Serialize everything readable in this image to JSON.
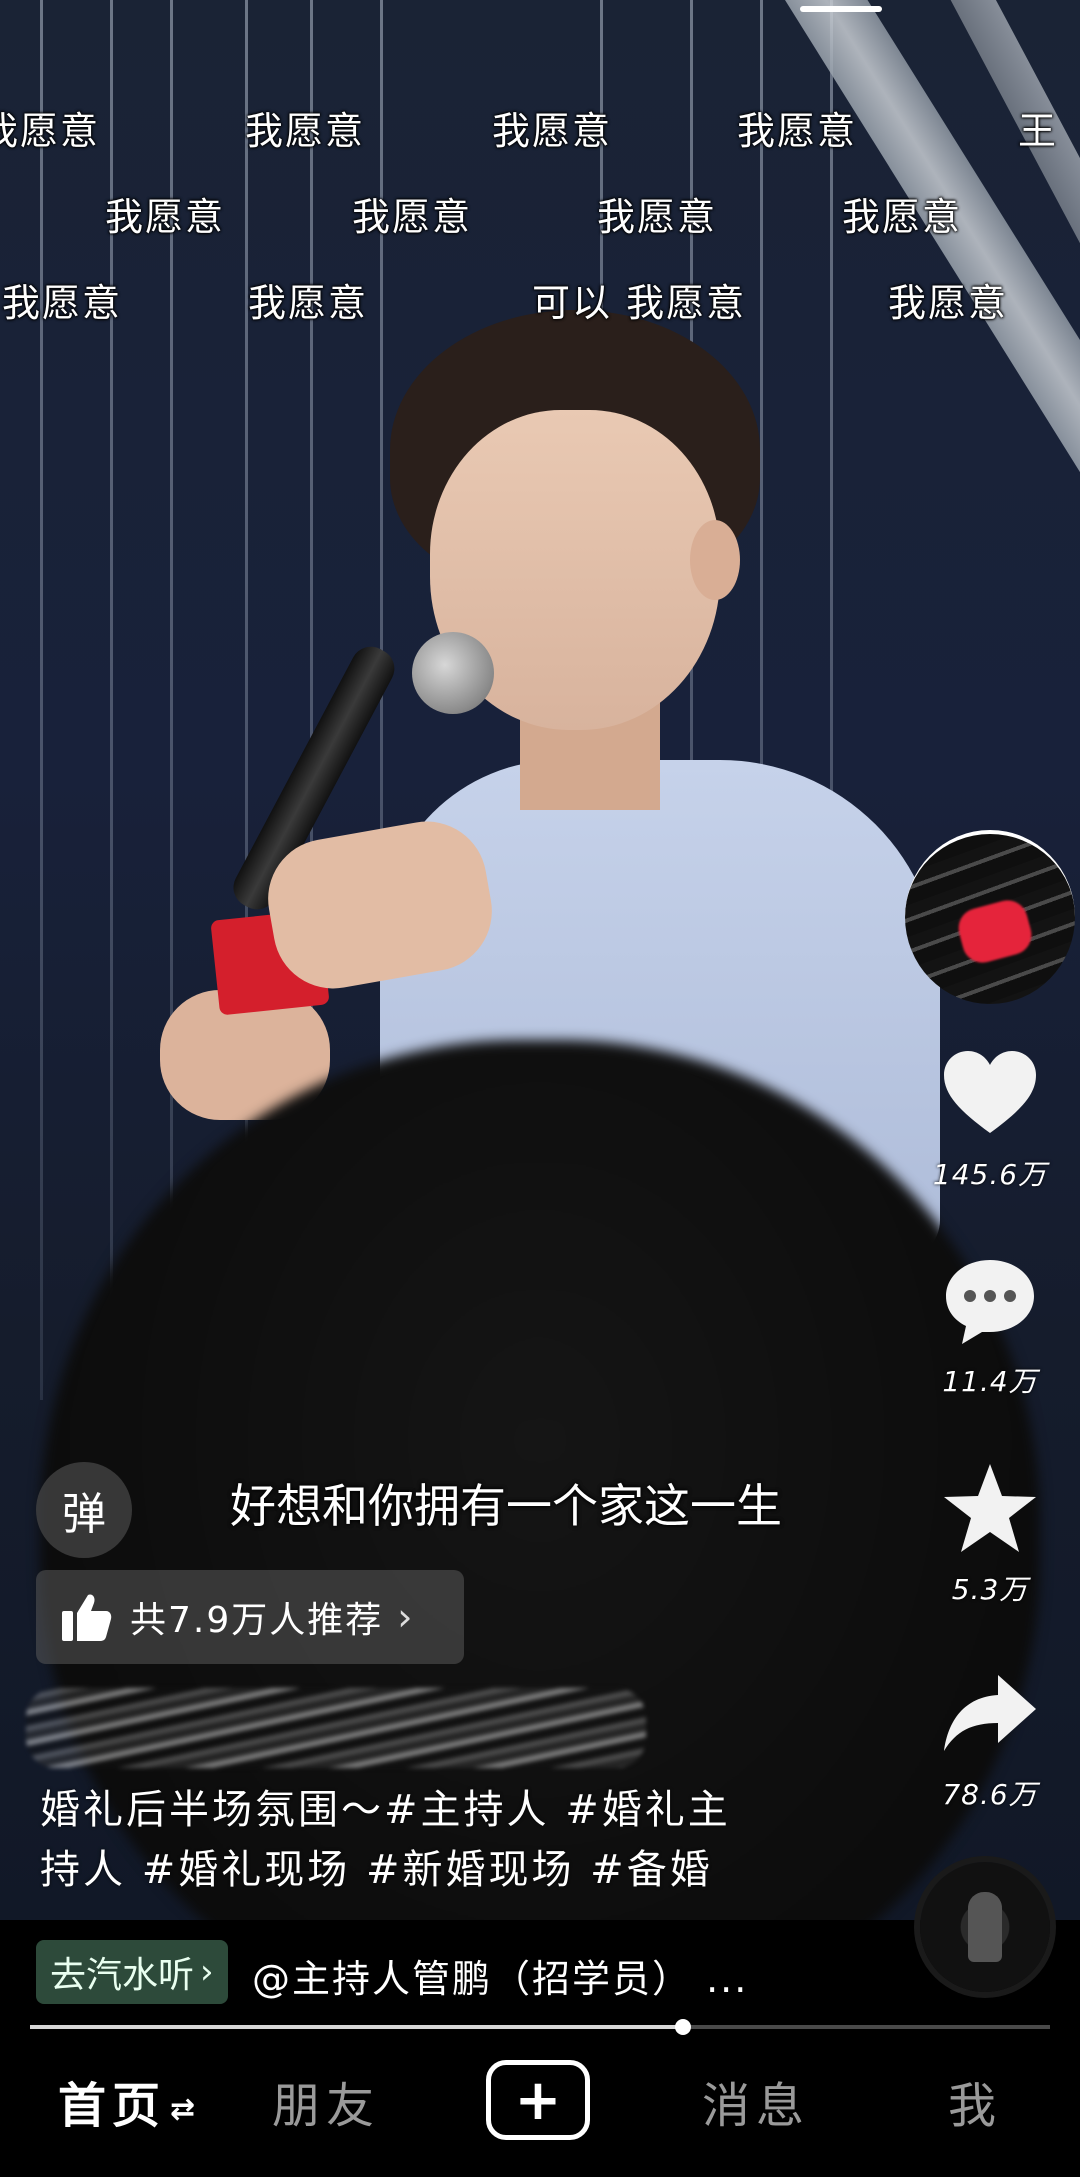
{
  "danmaku": [
    {
      "text": "我愿意"
    },
    {
      "text": "我愿意"
    },
    {
      "text": "我愿意"
    },
    {
      "text": "我愿意"
    },
    {
      "text": "王"
    },
    {
      "text": "我愿意"
    },
    {
      "text": "我愿意"
    },
    {
      "text": "我愿意"
    },
    {
      "text": "我愿意"
    },
    {
      "text": "我愿意"
    },
    {
      "text": "我愿意"
    },
    {
      "text": "可以 我愿意"
    },
    {
      "text": "我愿意"
    }
  ],
  "actions": {
    "like_count": "145.6万",
    "comment_count": "11.4万",
    "favorite_count": "5.3万",
    "share_count": "78.6万"
  },
  "danmu_button": "弹",
  "subtitle": "好想和你拥有一个家这一生",
  "recommend": {
    "text": "共7.9万人推荐",
    "chevron": "›"
  },
  "caption": {
    "line1": "婚礼后半场氛围～#主持人 #婚礼主",
    "line2": "持人 #婚礼现场 #新婚现场 #备婚"
  },
  "music": {
    "app_button": "去汽水听",
    "app_arrow": "›",
    "text": "@主持人管鹏（招学员） ..."
  },
  "progress": 0.64,
  "nav": {
    "home": "首页",
    "home_switch": "⇄",
    "friends": "朋友",
    "add": "+",
    "messages": "消息",
    "me": "我"
  },
  "icons": {
    "like": "heart-icon",
    "comment": "comment-icon",
    "favorite": "star-icon",
    "share": "share-icon",
    "recommend": "thumbs-up-icon"
  }
}
